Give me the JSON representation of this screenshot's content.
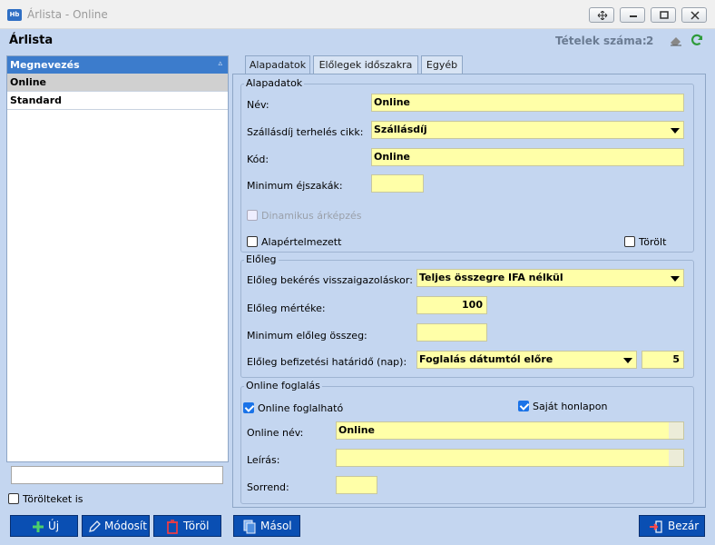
{
  "window": {
    "app_icon": "Hb",
    "title": "Árlista - Online"
  },
  "header": {
    "title": "Árlista",
    "count_label": "Tételek száma:",
    "count_value": "2"
  },
  "list": {
    "column_header": "Megnevezés",
    "items": [
      "Online",
      "Standard"
    ],
    "selected_index": 0,
    "show_deleted_label": "Törölteket is"
  },
  "tabs": [
    "Alapadatok",
    "Előlegek időszakra",
    "Egyéb"
  ],
  "basic": {
    "group_title": "Alapadatok",
    "name_label": "Név:",
    "name_value": "Online",
    "shipping_label": "Szállásdíj terhelés cikk:",
    "shipping_value": "Szállásdíj",
    "code_label": "Kód:",
    "code_value": "Online",
    "min_nights_label": "Minimum éjszakák:",
    "min_nights_value": "",
    "dynamic_pricing_label": "Dinamikus árképzés",
    "default_label": "Alapértelmezett",
    "deleted_label": "Törölt"
  },
  "deposit": {
    "group_title": "Előleg",
    "request_label": "Előleg bekérés visszaigazoláskor:",
    "request_value": "Teljes összegre IFA nélkül",
    "amount_label": "Előleg mértéke:",
    "amount_value": "100",
    "min_amount_label": "Minimum előleg összeg:",
    "min_amount_value": "",
    "deadline_label": "Előleg befizetési határidő (nap):",
    "deadline_mode": "Foglalás dátumtól előre",
    "deadline_days": "5"
  },
  "online": {
    "group_title": "Online foglalás",
    "bookable_label": "Online foglalható",
    "own_site_label": "Saját honlapon",
    "online_name_label": "Online név:",
    "online_name_value": "Online",
    "description_label": "Leírás:",
    "description_value": "",
    "order_label": "Sorrend:",
    "order_value": ""
  },
  "buttons": {
    "new": "Új",
    "edit": "Módosít",
    "delete": "Töröl",
    "copy": "Másol",
    "close": "Bezár"
  },
  "colors": {
    "panel_bg": "#c4d6f0",
    "header_blue": "#3c7ccc",
    "field_yellow": "#ffffa8",
    "button_blue": "#0a4fb3"
  }
}
